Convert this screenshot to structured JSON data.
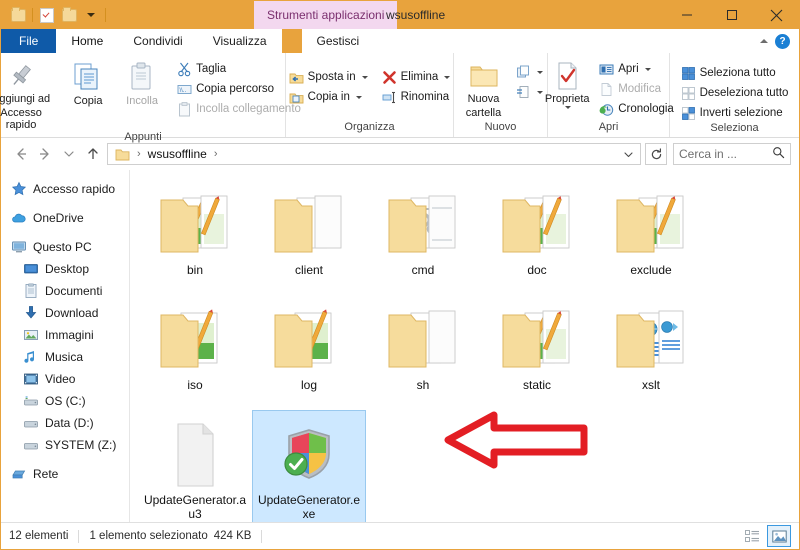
{
  "window": {
    "title": "wsusoffline",
    "contextual_tab_title": "Strumenti applicazioni",
    "accent_color": "#e8a33d",
    "contextual_color": "#f3d8ef",
    "minimize_label": "Riduci a icona",
    "maximize_label": "Ingrandisci",
    "close_label": "Chiudi"
  },
  "quick_access": {
    "items": [
      {
        "name": "folder-icon",
        "label": "Proprieta cartella"
      },
      {
        "name": "properties-icon",
        "label": "Proprieta"
      },
      {
        "name": "new-folder-icon",
        "label": "Nuova cartella"
      },
      {
        "name": "chevron-down-icon",
        "label": "Personalizza barra di accesso rapido"
      }
    ]
  },
  "ribbon": {
    "tabs": [
      {
        "label": "File",
        "active": false,
        "kind": "file"
      },
      {
        "label": "Home",
        "active": true,
        "kind": "normal"
      },
      {
        "label": "Condividi",
        "active": false,
        "kind": "normal"
      },
      {
        "label": "Visualizza",
        "active": false,
        "kind": "normal"
      },
      {
        "label": "Gestisci",
        "active": false,
        "kind": "contextual"
      }
    ],
    "collapse_label": "Riduci barra multifunzione",
    "help_label": "?",
    "groups": [
      {
        "label": "Appunti",
        "big_buttons": [
          {
            "label_line1": "Aggiungi ad",
            "label_line2": "Accesso rapido",
            "icon": "pin-icon",
            "disabled": false
          },
          {
            "label_line1": "Copia",
            "label_line2": "",
            "icon": "copy-icon",
            "disabled": false
          },
          {
            "label_line1": "Incolla",
            "label_line2": "",
            "icon": "paste-icon",
            "disabled": true
          }
        ],
        "small_buttons": [
          {
            "label": "Taglia",
            "icon": "scissors-icon",
            "disabled": false,
            "caret": false
          },
          {
            "label": "Copia percorso",
            "icon": "copy-path-icon",
            "disabled": false,
            "caret": false
          },
          {
            "label": "Incolla collegamento",
            "icon": "paste-shortcut-icon",
            "disabled": true,
            "caret": false
          }
        ]
      },
      {
        "label": "Organizza",
        "big_buttons": [],
        "small_buttons": [
          {
            "label": "Sposta in",
            "icon": "move-to-icon",
            "disabled": false,
            "caret": true
          },
          {
            "label": "Copia in",
            "icon": "copy-to-icon",
            "disabled": false,
            "caret": true
          }
        ],
        "small_buttons_2": [
          {
            "label": "Elimina",
            "icon": "delete-icon",
            "disabled": false,
            "caret": true
          },
          {
            "label": "Rinomina",
            "icon": "rename-icon",
            "disabled": false,
            "caret": false
          }
        ]
      },
      {
        "label": "Nuovo",
        "big_buttons": [
          {
            "label_line1": "Nuova",
            "label_line2": "cartella",
            "icon": "new-folder-icon",
            "disabled": false
          }
        ],
        "small_buttons": [
          {
            "label": "",
            "icon": "new-item-icon",
            "disabled": false,
            "caret": true
          },
          {
            "label": "",
            "icon": "easy-access-icon",
            "disabled": false,
            "caret": true
          }
        ]
      },
      {
        "label": "Apri",
        "big_buttons": [
          {
            "label_line1": "Proprieta",
            "label_line2": "",
            "icon": "properties-icon",
            "disabled": false,
            "split": true
          }
        ],
        "small_buttons": [
          {
            "label": "Apri",
            "icon": "open-icon",
            "disabled": false,
            "caret": true
          },
          {
            "label": "Modifica",
            "icon": "edit-icon",
            "disabled": true,
            "caret": false
          },
          {
            "label": "Cronologia",
            "icon": "history-icon",
            "disabled": false,
            "caret": false
          }
        ]
      },
      {
        "label": "Seleziona",
        "big_buttons": [],
        "small_buttons": [
          {
            "label": "Seleziona tutto",
            "icon": "select-all-icon",
            "disabled": false,
            "caret": false
          },
          {
            "label": "Deseleziona tutto",
            "icon": "select-none-icon",
            "disabled": false,
            "caret": false
          },
          {
            "label": "Inverti selezione",
            "icon": "invert-selection-icon",
            "disabled": false,
            "caret": false
          }
        ]
      }
    ]
  },
  "addressbar": {
    "back_label": "Indietro",
    "forward_label": "Avanti",
    "recent_label": "Percorsi recenti",
    "up_label": "Su",
    "breadcrumbs": [
      "wsusoffline"
    ],
    "dropdown_label": "Precedenti",
    "refresh_label": "Aggiorna",
    "search_placeholder": "Cerca in ..."
  },
  "navigation_pane": {
    "items": [
      {
        "label": "Accesso rapido",
        "icon": "star-icon",
        "indent": false
      },
      {
        "label": "OneDrive",
        "icon": "cloud-icon",
        "indent": false
      },
      {
        "label": "Questo PC",
        "icon": "computer-icon",
        "indent": false
      },
      {
        "label": "Desktop",
        "icon": "desktop-icon",
        "indent": true
      },
      {
        "label": "Documenti",
        "icon": "documents-icon",
        "indent": true
      },
      {
        "label": "Download",
        "icon": "download-icon",
        "indent": true
      },
      {
        "label": "Immagini",
        "icon": "pictures-icon",
        "indent": true
      },
      {
        "label": "Musica",
        "icon": "music-icon",
        "indent": true
      },
      {
        "label": "Video",
        "icon": "video-icon",
        "indent": true
      },
      {
        "label": "OS (C:)",
        "icon": "harddisk-icon",
        "indent": true
      },
      {
        "label": "Data (D:)",
        "icon": "drive-icon",
        "indent": true
      },
      {
        "label": "SYSTEM (Z:)",
        "icon": "drive-icon",
        "indent": true
      },
      {
        "label": "Rete",
        "icon": "network-icon",
        "indent": false
      }
    ]
  },
  "files": {
    "items": [
      {
        "name": "bin",
        "type": "folder",
        "content": "images",
        "selected": false
      },
      {
        "name": "client",
        "type": "folder",
        "content": "blank",
        "selected": false
      },
      {
        "name": "cmd",
        "type": "folder",
        "content": "gears",
        "selected": false
      },
      {
        "name": "doc",
        "type": "folder",
        "content": "images",
        "selected": false
      },
      {
        "name": "exclude",
        "type": "folder",
        "content": "images",
        "selected": false
      },
      {
        "name": "iso",
        "type": "folder",
        "content": "image1",
        "selected": false
      },
      {
        "name": "log",
        "type": "folder",
        "content": "image1",
        "selected": false
      },
      {
        "name": "sh",
        "type": "folder",
        "content": "blank",
        "selected": false
      },
      {
        "name": "static",
        "type": "folder",
        "content": "images",
        "selected": false
      },
      {
        "name": "xslt",
        "type": "folder",
        "content": "xml",
        "selected": false
      },
      {
        "name": "UpdateGenerator.au3",
        "type": "file",
        "content": "blankdoc",
        "selected": false
      },
      {
        "name": "UpdateGenerator.exe",
        "type": "file",
        "content": "shield",
        "selected": true
      }
    ]
  },
  "annotation": {
    "shape": "left-arrow",
    "color": "#e31e24"
  },
  "statusbar": {
    "item_count": "12 elementi",
    "selection": "1 elemento selezionato",
    "size": "424 KB",
    "view_details_label": "Visualizza dettagli",
    "view_large_label": "Visualizza icone grandi"
  }
}
